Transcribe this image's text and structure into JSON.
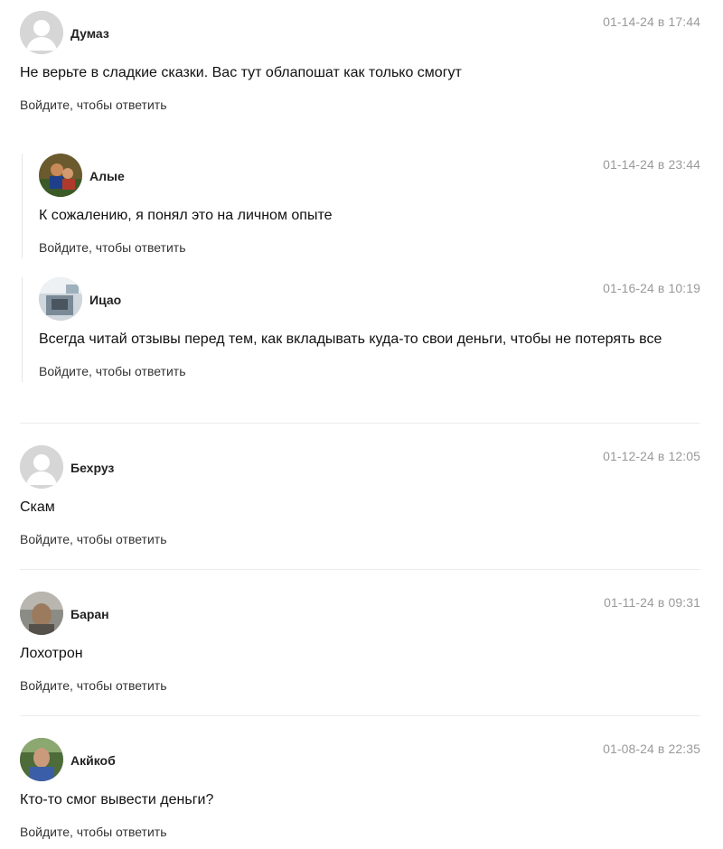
{
  "comments": [
    {
      "author": "Думаз",
      "date": "01-14-24 в 17:44",
      "text": "Не верьте в сладкие сказки. Вас тут облапошат как только смогут",
      "reply_link": "Войдите, чтобы ответить",
      "avatar": "default-avatar-icon",
      "replies": [
        {
          "author": "Алые",
          "date": "01-14-24 в 23:44",
          "text": "К сожалению, я понял это на личном опыте",
          "reply_link": "Войдите, чтобы ответить",
          "avatar": "user-photo"
        },
        {
          "author": "Ицао",
          "date": "01-16-24 в 10:19",
          "text": "Всегда читай отзывы перед тем, как вкладывать куда-то свои деньги, чтобы не потерять все",
          "reply_link": "Войдите, чтобы ответить",
          "avatar": "user-photo"
        }
      ]
    },
    {
      "author": "Бехруз",
      "date": "01-12-24 в 12:05",
      "text": "Скам",
      "reply_link": "Войдите, чтобы ответить",
      "avatar": "default-avatar-icon"
    },
    {
      "author": "Баран",
      "date": "01-11-24 в 09:31",
      "text": "Лохотрон",
      "reply_link": "Войдите, чтобы ответить",
      "avatar": "user-photo"
    },
    {
      "author": "Акйкоб",
      "date": "01-08-24 в 22:35",
      "text": "Кто-то смог вывести деньги?",
      "reply_link": "Войдите, чтобы ответить",
      "avatar": "user-photo"
    }
  ]
}
